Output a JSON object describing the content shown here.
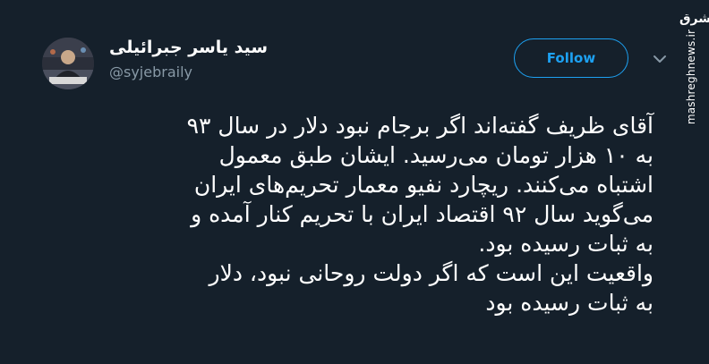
{
  "author": {
    "display_name": "سید یاسر جبرائیلی",
    "handle": "@syjebraily"
  },
  "actions": {
    "follow_label": "Follow"
  },
  "watermark": {
    "logo": "مشرق",
    "site": "mashreghnews.ir"
  },
  "tweet": {
    "lines": [
      "آقای ظریف گفته‌اند اگر برجام نبود دلار در سال ۹۳",
      "به ۱۰ هزار تومان می‌رسید. ایشان طبق معمول",
      "اشتباه می‌کنند. ریچارد نفیو معمار تحریم‌های ایران",
      "می‌گوید سال ۹۲ اقتصاد ایران با تحریم کنار آمده و",
      "به ثبات رسیده بود.",
      "واقعیت این است که اگر دولت روحانی نبود، دلار",
      "به ثبات رسیده بود"
    ]
  },
  "colors": {
    "background": "#15202b",
    "accent": "#1da1f2",
    "secondary_text": "#8899a6"
  },
  "icons": {
    "avatar": "profile-photo",
    "chevron": "chevron-down-icon"
  }
}
